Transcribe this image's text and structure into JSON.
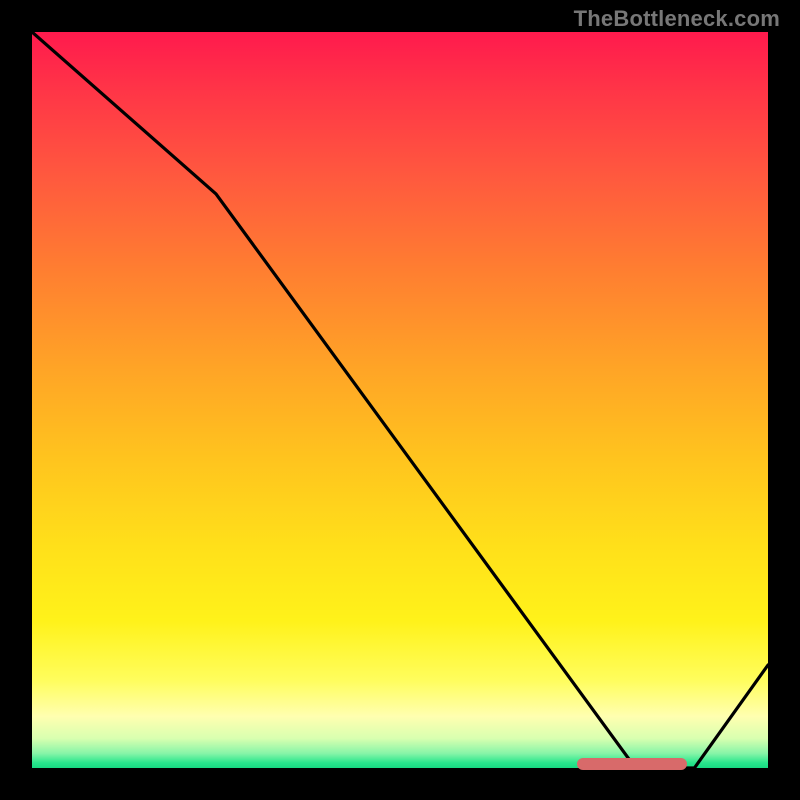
{
  "watermark": "TheBottleneck.com",
  "chart_data": {
    "type": "line",
    "x": [
      0,
      25,
      82,
      90,
      100
    ],
    "values": [
      100,
      78,
      0,
      0,
      14
    ],
    "xlim": [
      0,
      100
    ],
    "ylim": [
      0,
      100
    ],
    "title": "",
    "xlabel": "",
    "ylabel": "",
    "background": "heat-gradient",
    "marker_range_x": [
      74,
      89
    ]
  }
}
